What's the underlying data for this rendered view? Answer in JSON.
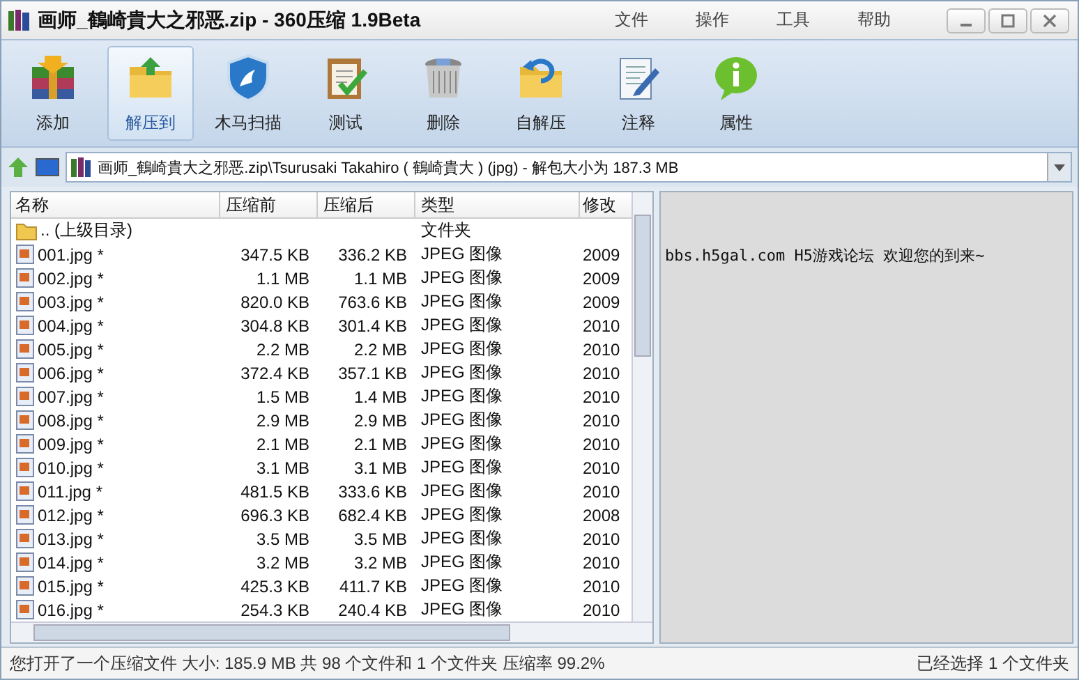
{
  "window": {
    "title": "画师_鶴崎貴大之邪恶.zip - 360压缩 1.9Beta"
  },
  "menu": [
    "文件",
    "操作",
    "工具",
    "帮助"
  ],
  "toolbar": [
    {
      "kind": "add",
      "label": "添加",
      "selected": false
    },
    {
      "kind": "extract",
      "label": "解压到",
      "selected": true
    },
    {
      "kind": "scan",
      "label": "木马扫描",
      "selected": false
    },
    {
      "kind": "test",
      "label": "测试",
      "selected": false
    },
    {
      "kind": "delete",
      "label": "删除",
      "selected": false
    },
    {
      "kind": "sfx",
      "label": "自解压",
      "selected": false
    },
    {
      "kind": "comment",
      "label": "注释",
      "selected": false
    },
    {
      "kind": "info",
      "label": "属性",
      "selected": false
    }
  ],
  "address": {
    "value": "画师_鶴崎貴大之邪恶.zip\\Tsurusaki Takahiro ( 鶴崎貴大 ) (jpg) - 解包大小为 187.3 MB"
  },
  "table": {
    "columns": [
      "名称",
      "压缩前",
      "压缩后",
      "类型",
      "修改"
    ],
    "rows": [
      {
        "kind": "folder",
        "name": ".. (上级目录)",
        "before": "",
        "after": "",
        "type": "文件夹",
        "date": ""
      },
      {
        "kind": "file",
        "name": "001.jpg *",
        "before": "347.5 KB",
        "after": "336.2 KB",
        "type": "JPEG 图像",
        "date": "2009"
      },
      {
        "kind": "file",
        "name": "002.jpg *",
        "before": "1.1 MB",
        "after": "1.1 MB",
        "type": "JPEG 图像",
        "date": "2009"
      },
      {
        "kind": "file",
        "name": "003.jpg *",
        "before": "820.0 KB",
        "after": "763.6 KB",
        "type": "JPEG 图像",
        "date": "2009"
      },
      {
        "kind": "file",
        "name": "004.jpg *",
        "before": "304.8 KB",
        "after": "301.4 KB",
        "type": "JPEG 图像",
        "date": "2010"
      },
      {
        "kind": "file",
        "name": "005.jpg *",
        "before": "2.2 MB",
        "after": "2.2 MB",
        "type": "JPEG 图像",
        "date": "2010"
      },
      {
        "kind": "file",
        "name": "006.jpg *",
        "before": "372.4 KB",
        "after": "357.1 KB",
        "type": "JPEG 图像",
        "date": "2010"
      },
      {
        "kind": "file",
        "name": "007.jpg *",
        "before": "1.5 MB",
        "after": "1.4 MB",
        "type": "JPEG 图像",
        "date": "2010"
      },
      {
        "kind": "file",
        "name": "008.jpg *",
        "before": "2.9 MB",
        "after": "2.9 MB",
        "type": "JPEG 图像",
        "date": "2010"
      },
      {
        "kind": "file",
        "name": "009.jpg *",
        "before": "2.1 MB",
        "after": "2.1 MB",
        "type": "JPEG 图像",
        "date": "2010"
      },
      {
        "kind": "file",
        "name": "010.jpg *",
        "before": "3.1 MB",
        "after": "3.1 MB",
        "type": "JPEG 图像",
        "date": "2010"
      },
      {
        "kind": "file",
        "name": "011.jpg *",
        "before": "481.5 KB",
        "after": "333.6 KB",
        "type": "JPEG 图像",
        "date": "2010"
      },
      {
        "kind": "file",
        "name": "012.jpg *",
        "before": "696.3 KB",
        "after": "682.4 KB",
        "type": "JPEG 图像",
        "date": "2008"
      },
      {
        "kind": "file",
        "name": "013.jpg *",
        "before": "3.5 MB",
        "after": "3.5 MB",
        "type": "JPEG 图像",
        "date": "2010"
      },
      {
        "kind": "file",
        "name": "014.jpg *",
        "before": "3.2 MB",
        "after": "3.2 MB",
        "type": "JPEG 图像",
        "date": "2010"
      },
      {
        "kind": "file",
        "name": "015.jpg *",
        "before": "425.3 KB",
        "after": "411.7 KB",
        "type": "JPEG 图像",
        "date": "2010"
      },
      {
        "kind": "file",
        "name": "016.jpg *",
        "before": "254.3 KB",
        "after": "240.4 KB",
        "type": "JPEG 图像",
        "date": "2010"
      }
    ]
  },
  "comment": "bbs.h5gal.com H5游戏论坛 欢迎您的到来~",
  "status_bar": {
    "left": "您打开了一个压缩文件 大小: 185.9 MB 共 98 个文件和 1 个文件夹 压缩率 99.2%",
    "right": "已经选择 1 个文件夹"
  }
}
